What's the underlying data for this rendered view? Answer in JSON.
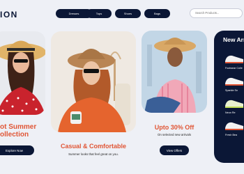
{
  "header": {
    "brand": "ION",
    "nav": [
      "Dresses",
      "Tops",
      "Shoes",
      "Bags"
    ],
    "search_placeholder": "Search Products..."
  },
  "cards": [
    {
      "headline_line1": "ot Summer",
      "headline_line2": "ollection",
      "button": "Explore Now"
    },
    {
      "headline": "Casual & Comfortable",
      "subtitle": "Summer looks that feel great on you.",
      "button": null
    },
    {
      "headline": "Upto 30% Off",
      "subtitle": "On selected new arrivals",
      "button": "View Offers"
    }
  ],
  "new_arrivals": {
    "title": "New Arr",
    "items": [
      "Footwear Colle",
      "Sparkle Sn",
      "Neon Re",
      "Fresh Bea"
    ]
  },
  "colors": {
    "navy": "#0b1736",
    "accent": "#e05535",
    "background": "#eef0f6"
  }
}
